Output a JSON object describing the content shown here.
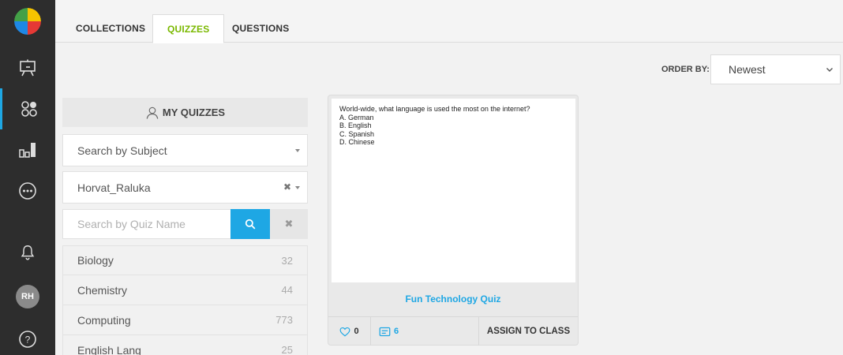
{
  "sidebar": {
    "items": [
      {
        "icon": "presentation-icon"
      },
      {
        "icon": "quiz-dots-icon",
        "active": true
      },
      {
        "icon": "bar-chart-icon"
      },
      {
        "icon": "more-icon"
      },
      {
        "icon": "bell-icon"
      }
    ],
    "avatar_initials": "RH",
    "help_label": "?"
  },
  "tabs": [
    {
      "label": "COLLECTIONS"
    },
    {
      "label": "QUIZZES",
      "active": true
    },
    {
      "label": "QUESTIONS"
    }
  ],
  "order": {
    "label": "ORDER BY:",
    "selected": "Newest"
  },
  "panel": {
    "title": "MY QUIZZES",
    "subject_dropdown": "Search by Subject",
    "author_dropdown": "Horvat_Raluka",
    "search_placeholder": "Search by Quiz Name",
    "subjects": [
      {
        "name": "Biology",
        "count": "32"
      },
      {
        "name": "Chemistry",
        "count": "44"
      },
      {
        "name": "Computing",
        "count": "773"
      },
      {
        "name": "English Lang",
        "count": "25"
      }
    ]
  },
  "quiz_card": {
    "question": "World-wide, what language is used the most on the internet?",
    "options": [
      "A. German",
      "B. English",
      "C. Spanish",
      "D. Chinese"
    ],
    "title": "Fun Technology Quiz",
    "likes": "0",
    "questions": "6",
    "assign_label": "ASSIGN TO CLASS"
  },
  "colors": {
    "accent_blue": "#1ea7e4",
    "accent_green": "#7ab800",
    "sidebar_bg": "#2d2d2d"
  }
}
